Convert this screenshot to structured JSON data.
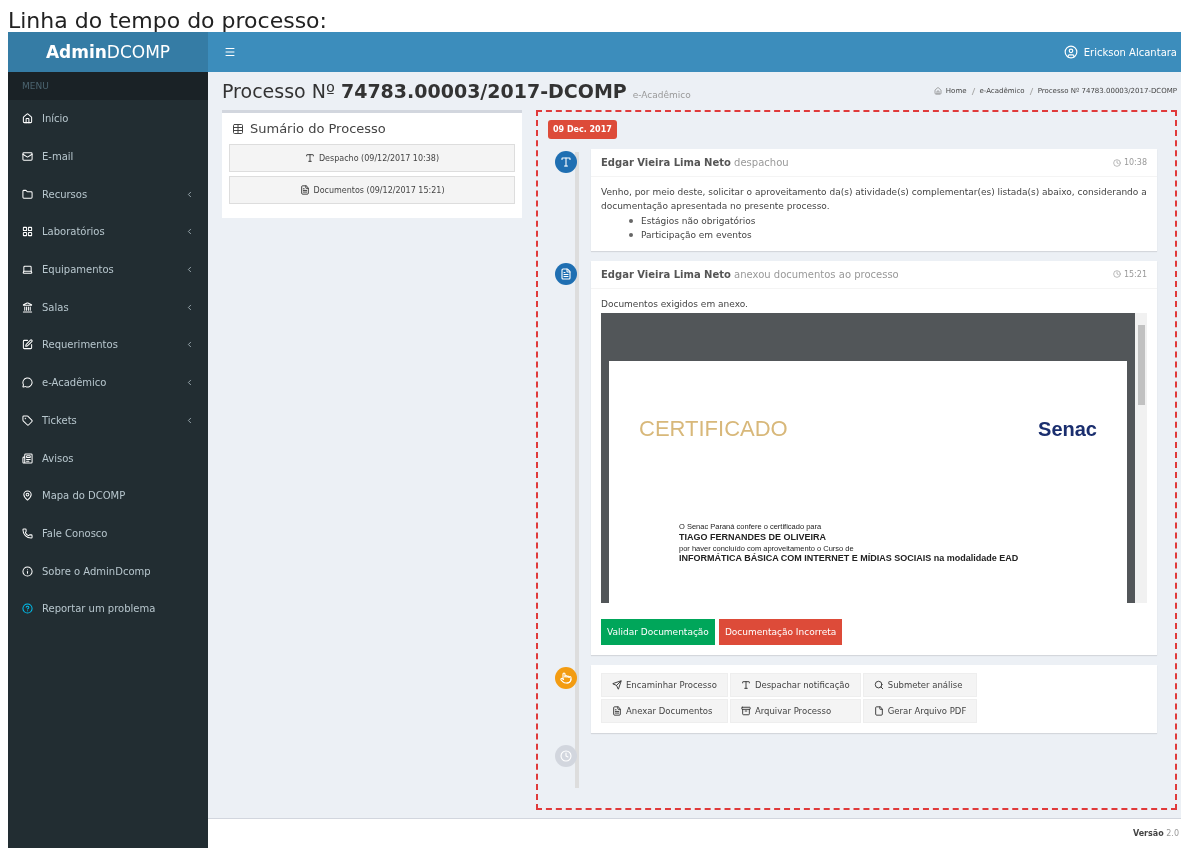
{
  "caption": "Linha do tempo do processo:",
  "brand": {
    "bold": "Admin",
    "light": "DCOMP"
  },
  "user": {
    "name": "Erickson Alcantara"
  },
  "sidebar": {
    "header": "MENU",
    "items": [
      {
        "label": "Início",
        "submenu": false
      },
      {
        "label": "E-mail",
        "submenu": false
      },
      {
        "label": "Recursos",
        "submenu": true
      },
      {
        "label": "Laboratórios",
        "submenu": true
      },
      {
        "label": "Equipamentos",
        "submenu": true
      },
      {
        "label": "Salas",
        "submenu": true
      },
      {
        "label": "Requerimentos",
        "submenu": true
      },
      {
        "label": "e-Acadêmico",
        "submenu": true
      },
      {
        "label": "Tickets",
        "submenu": true
      },
      {
        "label": "Avisos",
        "submenu": false
      },
      {
        "label": "Mapa do DCOMP",
        "submenu": false
      },
      {
        "label": "Fale Conosco",
        "submenu": false
      },
      {
        "label": "Sobre o AdminDcomp",
        "submenu": false
      },
      {
        "label": "Reportar um problema",
        "submenu": false
      }
    ]
  },
  "page": {
    "title_prefix": "Processo Nº",
    "title_number": "74783.00003/2017-DCOMP",
    "subtitle": "e-Acadêmico",
    "breadcrumb": [
      "Home",
      "e-Acadêmico",
      "Processo Nº 74783.00003/2017-DCOMP"
    ]
  },
  "summary": {
    "title": "Sumário do Processo",
    "items": [
      "Despacho (09/12/2017 10:38)",
      "Documentos (09/12/2017 15:21)"
    ]
  },
  "timeline": {
    "date": "09 Dec. 2017",
    "items": [
      {
        "kind": "dispatch",
        "color": "#1f6fb2",
        "author": "Edgar Vieira Lima Neto",
        "action": "despachou",
        "time": "10:38",
        "text": "Venho, por meio deste, solicitar o aproveitamento da(s) atividade(s) complementar(es) listada(s) abaixo, considerando a documentação apresentada no presente processo.",
        "list": [
          "Estágios não obrigatórios",
          "Participação em eventos"
        ]
      },
      {
        "kind": "attachment",
        "color": "#1f6fb2",
        "author": "Edgar Vieira Lima Neto",
        "action": "anexou documentos ao processo",
        "time": "15:21",
        "text": "Documentos exigidos em anexo.",
        "document": {
          "title": "CERTIFICADO",
          "logo": "Senac",
          "lines": [
            "O Senac Paraná confere o certificado para",
            "TIAGO FERNANDES DE OLIVEIRA",
            "por haver concluído com aproveitamento o Curso de",
            "INFORMÁTICA BÁSICA COM INTERNET E MÍDIAS SOCIAIS na modalidade EAD"
          ]
        },
        "buttons": [
          "Validar Documentação",
          "Documentação Incorreta"
        ]
      },
      {
        "kind": "actions",
        "color": "#f39c12",
        "buttons": [
          "Encaminhar Processo",
          "Despachar notificação",
          "Submeter análise",
          "Anexar Documentos",
          "Arquivar Processo",
          "Gerar Arquivo PDF"
        ]
      },
      {
        "kind": "end",
        "color": "#d2d6de"
      }
    ]
  },
  "footer": {
    "version_label": "Versão",
    "version": "2.0"
  }
}
